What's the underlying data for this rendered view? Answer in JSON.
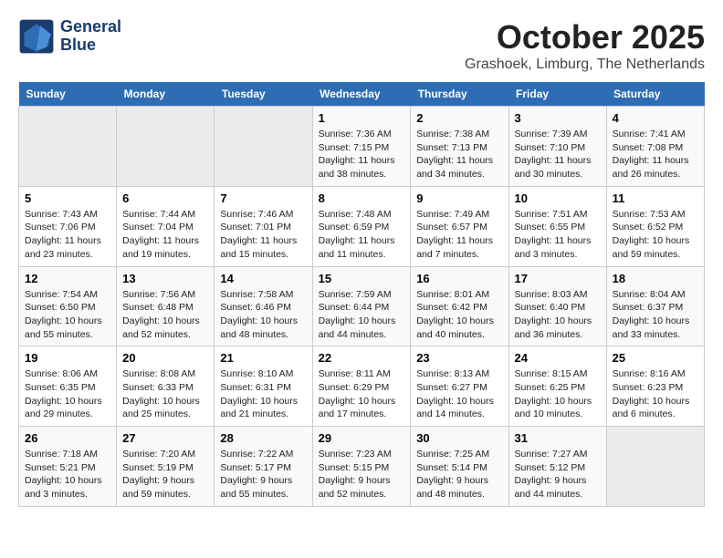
{
  "header": {
    "logo_line1": "General",
    "logo_line2": "Blue",
    "month": "October 2025",
    "location": "Grashoek, Limburg, The Netherlands"
  },
  "days_of_week": [
    "Sunday",
    "Monday",
    "Tuesday",
    "Wednesday",
    "Thursday",
    "Friday",
    "Saturday"
  ],
  "weeks": [
    [
      {
        "day": "",
        "info": ""
      },
      {
        "day": "",
        "info": ""
      },
      {
        "day": "",
        "info": ""
      },
      {
        "day": "1",
        "info": "Sunrise: 7:36 AM\nSunset: 7:15 PM\nDaylight: 11 hours\nand 38 minutes."
      },
      {
        "day": "2",
        "info": "Sunrise: 7:38 AM\nSunset: 7:13 PM\nDaylight: 11 hours\nand 34 minutes."
      },
      {
        "day": "3",
        "info": "Sunrise: 7:39 AM\nSunset: 7:10 PM\nDaylight: 11 hours\nand 30 minutes."
      },
      {
        "day": "4",
        "info": "Sunrise: 7:41 AM\nSunset: 7:08 PM\nDaylight: 11 hours\nand 26 minutes."
      }
    ],
    [
      {
        "day": "5",
        "info": "Sunrise: 7:43 AM\nSunset: 7:06 PM\nDaylight: 11 hours\nand 23 minutes."
      },
      {
        "day": "6",
        "info": "Sunrise: 7:44 AM\nSunset: 7:04 PM\nDaylight: 11 hours\nand 19 minutes."
      },
      {
        "day": "7",
        "info": "Sunrise: 7:46 AM\nSunset: 7:01 PM\nDaylight: 11 hours\nand 15 minutes."
      },
      {
        "day": "8",
        "info": "Sunrise: 7:48 AM\nSunset: 6:59 PM\nDaylight: 11 hours\nand 11 minutes."
      },
      {
        "day": "9",
        "info": "Sunrise: 7:49 AM\nSunset: 6:57 PM\nDaylight: 11 hours\nand 7 minutes."
      },
      {
        "day": "10",
        "info": "Sunrise: 7:51 AM\nSunset: 6:55 PM\nDaylight: 11 hours\nand 3 minutes."
      },
      {
        "day": "11",
        "info": "Sunrise: 7:53 AM\nSunset: 6:52 PM\nDaylight: 10 hours\nand 59 minutes."
      }
    ],
    [
      {
        "day": "12",
        "info": "Sunrise: 7:54 AM\nSunset: 6:50 PM\nDaylight: 10 hours\nand 55 minutes."
      },
      {
        "day": "13",
        "info": "Sunrise: 7:56 AM\nSunset: 6:48 PM\nDaylight: 10 hours\nand 52 minutes."
      },
      {
        "day": "14",
        "info": "Sunrise: 7:58 AM\nSunset: 6:46 PM\nDaylight: 10 hours\nand 48 minutes."
      },
      {
        "day": "15",
        "info": "Sunrise: 7:59 AM\nSunset: 6:44 PM\nDaylight: 10 hours\nand 44 minutes."
      },
      {
        "day": "16",
        "info": "Sunrise: 8:01 AM\nSunset: 6:42 PM\nDaylight: 10 hours\nand 40 minutes."
      },
      {
        "day": "17",
        "info": "Sunrise: 8:03 AM\nSunset: 6:40 PM\nDaylight: 10 hours\nand 36 minutes."
      },
      {
        "day": "18",
        "info": "Sunrise: 8:04 AM\nSunset: 6:37 PM\nDaylight: 10 hours\nand 33 minutes."
      }
    ],
    [
      {
        "day": "19",
        "info": "Sunrise: 8:06 AM\nSunset: 6:35 PM\nDaylight: 10 hours\nand 29 minutes."
      },
      {
        "day": "20",
        "info": "Sunrise: 8:08 AM\nSunset: 6:33 PM\nDaylight: 10 hours\nand 25 minutes."
      },
      {
        "day": "21",
        "info": "Sunrise: 8:10 AM\nSunset: 6:31 PM\nDaylight: 10 hours\nand 21 minutes."
      },
      {
        "day": "22",
        "info": "Sunrise: 8:11 AM\nSunset: 6:29 PM\nDaylight: 10 hours\nand 17 minutes."
      },
      {
        "day": "23",
        "info": "Sunrise: 8:13 AM\nSunset: 6:27 PM\nDaylight: 10 hours\nand 14 minutes."
      },
      {
        "day": "24",
        "info": "Sunrise: 8:15 AM\nSunset: 6:25 PM\nDaylight: 10 hours\nand 10 minutes."
      },
      {
        "day": "25",
        "info": "Sunrise: 8:16 AM\nSunset: 6:23 PM\nDaylight: 10 hours\nand 6 minutes."
      }
    ],
    [
      {
        "day": "26",
        "info": "Sunrise: 7:18 AM\nSunset: 5:21 PM\nDaylight: 10 hours\nand 3 minutes."
      },
      {
        "day": "27",
        "info": "Sunrise: 7:20 AM\nSunset: 5:19 PM\nDaylight: 9 hours\nand 59 minutes."
      },
      {
        "day": "28",
        "info": "Sunrise: 7:22 AM\nSunset: 5:17 PM\nDaylight: 9 hours\nand 55 minutes."
      },
      {
        "day": "29",
        "info": "Sunrise: 7:23 AM\nSunset: 5:15 PM\nDaylight: 9 hours\nand 52 minutes."
      },
      {
        "day": "30",
        "info": "Sunrise: 7:25 AM\nSunset: 5:14 PM\nDaylight: 9 hours\nand 48 minutes."
      },
      {
        "day": "31",
        "info": "Sunrise: 7:27 AM\nSunset: 5:12 PM\nDaylight: 9 hours\nand 44 minutes."
      },
      {
        "day": "",
        "info": ""
      }
    ]
  ]
}
